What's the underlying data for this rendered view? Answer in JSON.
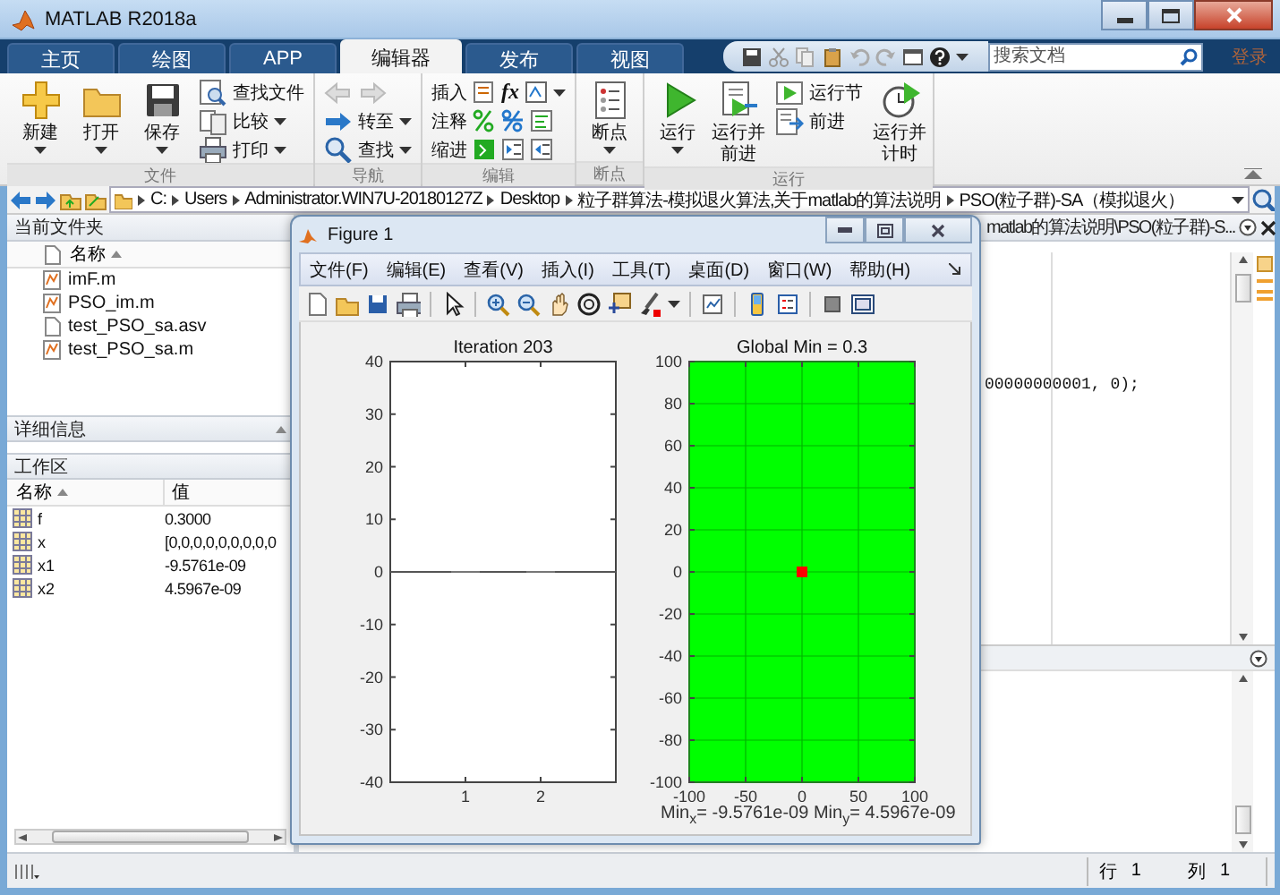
{
  "window": {
    "title": "MATLAB R2018a"
  },
  "tabs": [
    {
      "label": "主页",
      "selected": false
    },
    {
      "label": "绘图",
      "selected": false
    },
    {
      "label": "APP",
      "selected": false
    },
    {
      "label": "编辑器",
      "selected": true
    },
    {
      "label": "发布",
      "selected": false
    },
    {
      "label": "视图",
      "selected": false
    }
  ],
  "search": {
    "placeholder": "搜索文档"
  },
  "sign_in": "登录",
  "ribbon": {
    "groups": [
      {
        "label": "文件",
        "columns": [
          {
            "kind": "large",
            "label": "新建",
            "dropdown": true
          },
          {
            "kind": "large",
            "label": "打开",
            "dropdown": true
          },
          {
            "kind": "large",
            "label": "保存",
            "dropdown": true
          },
          {
            "kind": "stack",
            "rows": [
              {
                "kind": "button",
                "label": "查找文件",
                "dropdown": false
              },
              {
                "kind": "button",
                "label": "比较",
                "dropdown": true
              },
              {
                "kind": "button",
                "label": "打印",
                "dropdown": true
              }
            ]
          }
        ]
      },
      {
        "label": "导航",
        "columns": [
          {
            "kind": "stack",
            "rows": [
              {
                "kind": "arrows"
              },
              {
                "kind": "button",
                "label": "转至",
                "dropdown": true
              },
              {
                "kind": "button",
                "label": "查找",
                "dropdown": true
              }
            ]
          }
        ]
      },
      {
        "label": "编辑",
        "columns": [
          {
            "kind": "stack",
            "rows": [
              {
                "kind": "tools",
                "label": "插入",
                "symbol": "fx",
                "dropdown": true
              },
              {
                "kind": "tools",
                "label": "注释",
                "dropdown": false
              },
              {
                "kind": "tools",
                "label": "缩进",
                "dropdown": false
              }
            ]
          }
        ]
      },
      {
        "label": "断点",
        "columns": [
          {
            "kind": "large",
            "label": "断点",
            "dropdown": true
          }
        ]
      },
      {
        "label": "运行",
        "columns": [
          {
            "kind": "large",
            "label": "运行",
            "dropdown": true
          },
          {
            "kind": "large",
            "label": "运行并前进",
            "dropdown": false
          },
          {
            "kind": "stack",
            "rows": [
              {
                "kind": "button",
                "label": "运行节",
                "dropdown": false
              },
              {
                "kind": "button",
                "label": "前进",
                "dropdown": false
              }
            ]
          },
          {
            "kind": "large",
            "label": "运行并计时",
            "dropdown": false
          }
        ]
      }
    ]
  },
  "address": {
    "segments": [
      "C:",
      "Users",
      "Administrator.WIN7U-20180127Z",
      "Desktop",
      "粒子群算法-模拟退火算法,关于matlab的算法说明",
      "PSO(粒子群)-SA（模拟退火）"
    ]
  },
  "current_folder": {
    "title": "当前文件夹",
    "column": "名称",
    "files": [
      {
        "name": "imF.m",
        "kind": "m"
      },
      {
        "name": "PSO_im.m",
        "kind": "m"
      },
      {
        "name": "test_PSO_sa.asv",
        "kind": "asv"
      },
      {
        "name": "test_PSO_sa.m",
        "kind": "m"
      }
    ]
  },
  "details": {
    "title": "详细信息"
  },
  "workspace": {
    "title": "工作区",
    "columns": [
      "名称",
      "值"
    ],
    "rows": [
      {
        "name": "f",
        "value": "0.3000"
      },
      {
        "name": "x",
        "value": "[0,0,0,0,0,0,0,0,0"
      },
      {
        "name": "x1",
        "value": "-9.5761e-09"
      },
      {
        "name": "x2",
        "value": "4.5967e-09"
      }
    ]
  },
  "editor": {
    "header": "matlab的算法说明\\PSO(粒子群)-S...",
    "code_line": "00000000001, 0);"
  },
  "status_bar": {
    "line_label": "行",
    "line": "1",
    "column_label": "列",
    "column": "1"
  },
  "figure": {
    "title": "Figure 1",
    "menu": [
      "文件(F)",
      "编辑(E)",
      "查看(V)",
      "插入(I)",
      "工具(T)",
      "桌面(D)",
      "窗口(W)",
      "帮助(H)"
    ],
    "plots": [
      {
        "chart_data": {
          "type": "bar",
          "title": "Iteration  203",
          "categories": [
            "1",
            "2"
          ],
          "values": [
            0,
            0
          ],
          "ylim": [
            -40,
            40
          ],
          "yticks": [
            -40,
            -30,
            -20,
            -10,
            0,
            10,
            20,
            30,
            40
          ]
        }
      },
      {
        "chart_data": {
          "type": "scatter",
          "title": "Global Min =  0.3",
          "xlabel": "Min$_{x}$= -9.5761e-09  Min$_{y}$= 4.5967e-09",
          "grid": true,
          "x": [
            0
          ],
          "series": [
            {
              "color": "#ff0000",
              "values": [
                0
              ]
            }
          ],
          "xlim": [
            -100,
            100
          ],
          "ylim": [
            -100,
            100
          ],
          "xticks": [
            -100,
            -50,
            0,
            50,
            100
          ],
          "yticks": [
            -100,
            -80,
            -60,
            -40,
            -20,
            0,
            20,
            40,
            60,
            80,
            100
          ]
        }
      }
    ]
  }
}
